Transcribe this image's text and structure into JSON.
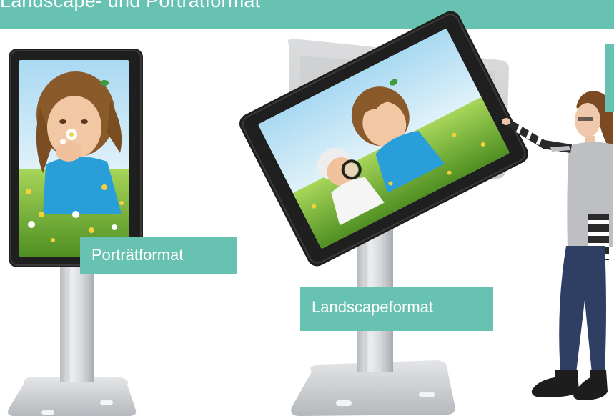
{
  "header": {
    "title": "Landscape- und Porträtformat"
  },
  "labels": {
    "portrait": "Porträtformat",
    "landscape": "Landscapeformat"
  },
  "colors": {
    "accent": "#67c2b1",
    "bezel": "#1e1e1e",
    "stand": "#c9cbce",
    "sky": "#bfe3f5",
    "grass": "#7ab83a"
  }
}
